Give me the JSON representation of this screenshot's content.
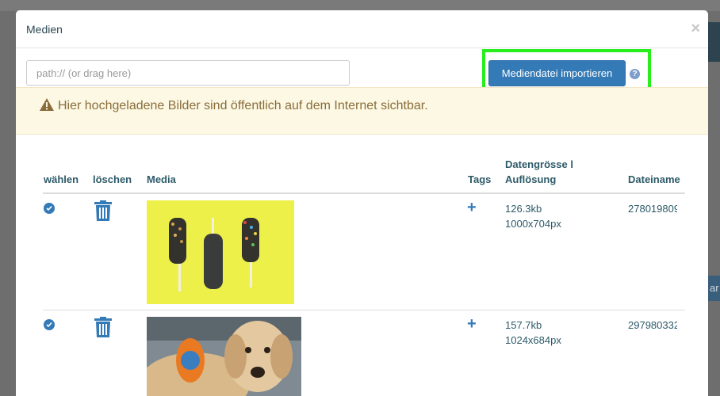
{
  "modal": {
    "title": "Medien",
    "close_label": "×"
  },
  "import": {
    "path_placeholder": "path:// (or drag here)",
    "button_label": "Mediendatei importieren",
    "help_label": "?"
  },
  "warning": {
    "text": "Hier hochgeladene Bilder sind öffentlich auf dem Internet sichtbar."
  },
  "table": {
    "headers": {
      "select": "wählen",
      "delete": "löschen",
      "media": "Media",
      "tags": "Tags",
      "size_line1": "Datengrösse l",
      "size_line2": "Auflösung",
      "filename": "Dateiname"
    },
    "rows": [
      {
        "size": "126.3kb",
        "resolution": "1000x704px",
        "filename": "278019809",
        "image": "popsicles-on-yellow"
      },
      {
        "size": "157.7kb",
        "resolution": "1024x684px",
        "filename": "297980332",
        "image": "golden-retriever-guide-dog"
      }
    ]
  },
  "background": {
    "right_button_fragment": "ar"
  },
  "colors": {
    "primary": "#347ab7",
    "highlight": "#27ee1c",
    "warning_bg": "#fcf8e3",
    "warning_text": "#8a6d3b",
    "header_text": "#2d5a69"
  }
}
